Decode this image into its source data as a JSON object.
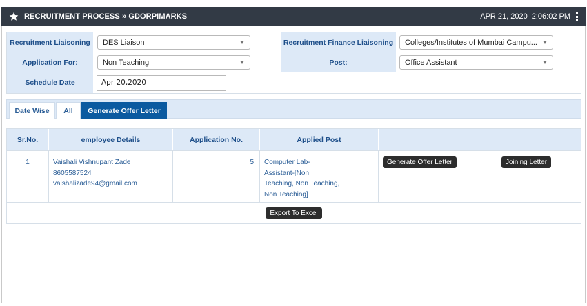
{
  "header": {
    "title": "RECRUITMENT PROCESS » GDORPIMARKS",
    "date": "APR 21, 2020",
    "time": "2:06:02 PM"
  },
  "form": {
    "recruitment_liaisoning": {
      "label": "Recruitment Liaisoning",
      "value": "DES Liaison"
    },
    "finance_liaisoning": {
      "label": "Recruitment Finance Liaisoning",
      "value": "Colleges/Institutes of Mumbai Campu..."
    },
    "application_for": {
      "label": "Application For:",
      "value": "Non Teaching"
    },
    "post": {
      "label": "Post:",
      "value": "Office Assistant"
    },
    "schedule_date": {
      "label": "Schedule Date",
      "value": "Apr 20,2020"
    }
  },
  "tabs": [
    "Date Wise",
    "All",
    "Generate Offer Letter"
  ],
  "table": {
    "headers": [
      "Sr.No.",
      "employee Details",
      "Application No.",
      "Applied Post",
      "",
      ""
    ],
    "rows": [
      {
        "sr": "1",
        "name": "Vaishali Vishnupant Zade",
        "phone": "8605587524",
        "email": "vaishalizade94@gmail.com",
        "application_no": "5",
        "applied_post": [
          "Computer Lab-",
          "Assistant-[Non",
          "Teaching, Non Teaching,",
          "Non Teaching]"
        ],
        "offer_button": "Generate Offer Letter",
        "joining_button": "Joining Letter"
      }
    ],
    "export_button": "Export To Excel"
  }
}
